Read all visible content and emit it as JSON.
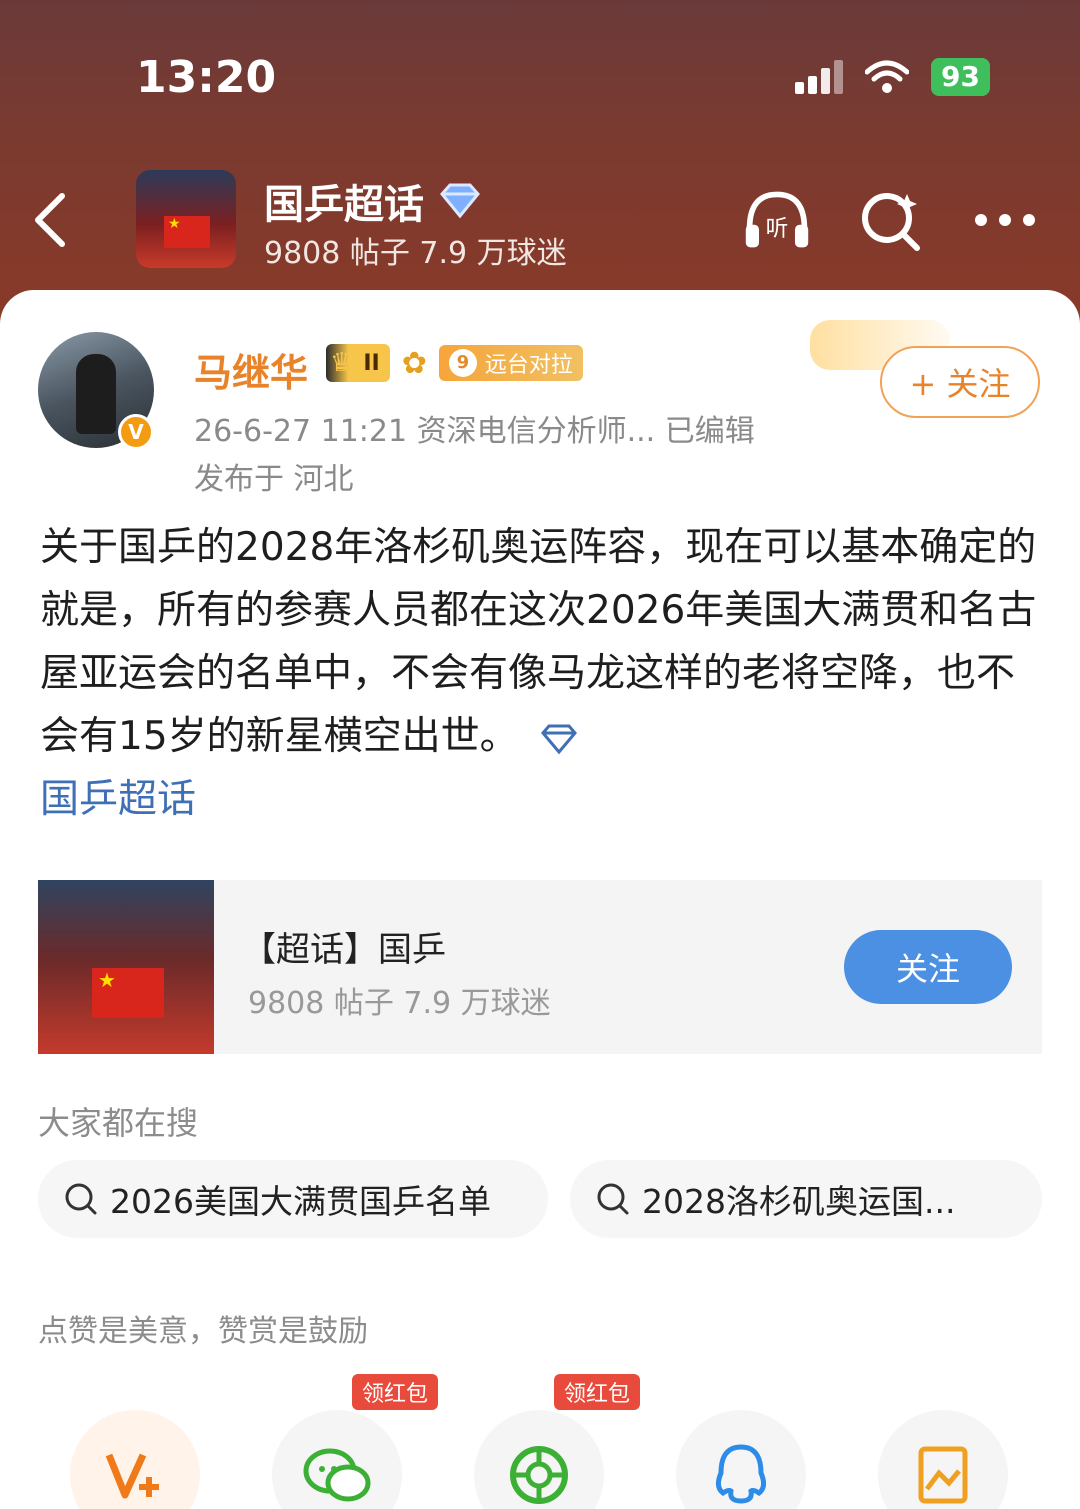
{
  "status_bar": {
    "time": "13:20",
    "battery": "93"
  },
  "header": {
    "title": "国乒超话",
    "subtitle": "9808 帖子 7.9 万球迷"
  },
  "post": {
    "user_name": "马继华",
    "crown_label": "II",
    "level_num": "9",
    "level_label": "远台对拉",
    "follow_label": "+ 关注",
    "meta": "26-6-27 11:21  资深电信分析师...  已编辑",
    "location": "发布于 河北",
    "text": "关于国乒的2028年洛杉矶奥运阵容，现在可以基本确定的就是，所有的参赛人员都在这次2026年美国大满贯和名古屋亚运会的名单中，不会有像马龙这样的老将空降，也不会有15岁的新星横空出世。",
    "topic_link": "国乒超话"
  },
  "topic_card": {
    "title": "【超话】国乒",
    "subtitle": "9808 帖子 7.9 万球迷",
    "follow_label": "关注"
  },
  "search": {
    "heading": "大家都在搜",
    "chips": [
      "2026美国大满贯国乒名单",
      "2028洛杉矶奥运国..."
    ]
  },
  "reward_text": "点赞是美意，赞赏是鼓励",
  "share": {
    "redpack_label": "领红包",
    "items": [
      "v-plus-icon",
      "wechat-icon",
      "moments-icon",
      "qq-icon",
      "image-icon"
    ]
  },
  "colors": {
    "accent_orange": "#e8832a",
    "link_blue": "#3f6fb5",
    "follow_blue": "#4b90e2"
  }
}
